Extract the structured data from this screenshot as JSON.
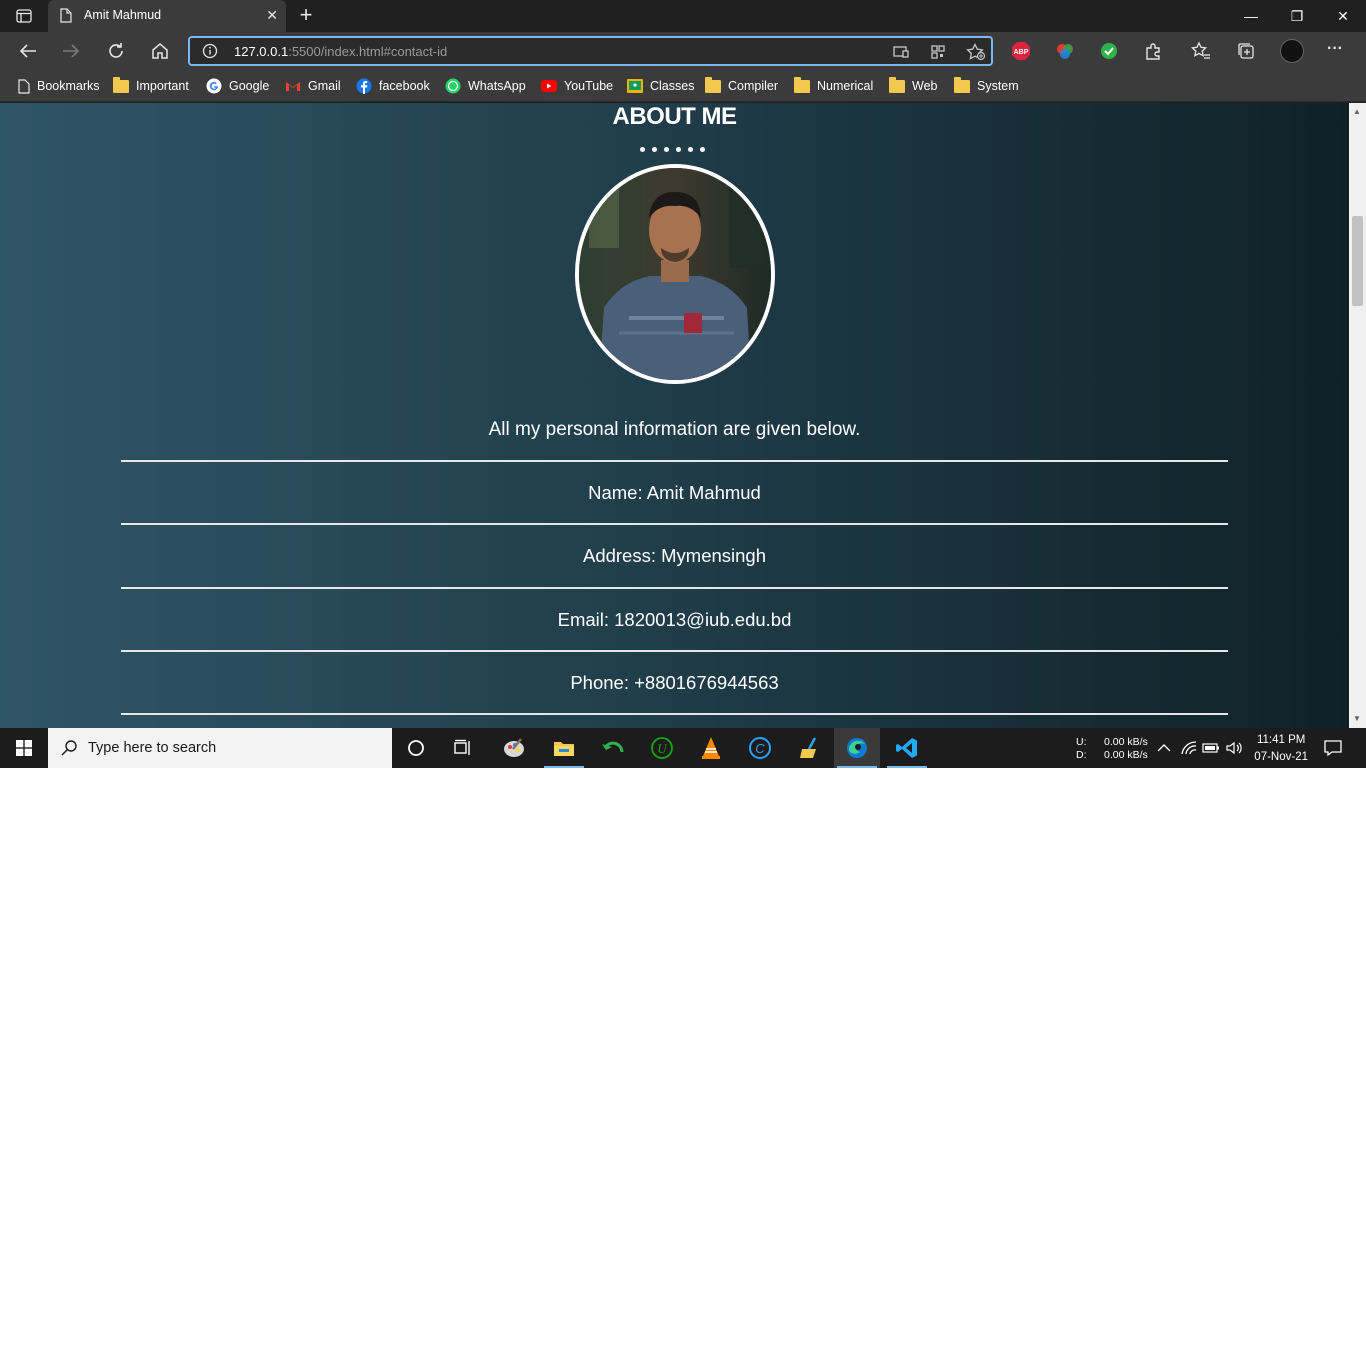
{
  "browser": {
    "tab": {
      "title": "Amit Mahmud",
      "close_glyph": "✕"
    },
    "new_tab_glyph": "+",
    "address": {
      "host": "127.0.0.1",
      "rest": ":5500/index.html#contact-id"
    },
    "window_controls": {
      "minimize": "—",
      "restore": "❐",
      "close": "✕"
    },
    "extensions": {
      "abp_label": "ABP"
    },
    "menu_glyph": "···"
  },
  "bookmarks": [
    {
      "label": "Bookmarks",
      "icon": "page-icon"
    },
    {
      "label": "Important",
      "icon": "folder-icon"
    },
    {
      "label": "Google",
      "icon": "google-icon"
    },
    {
      "label": "Gmail",
      "icon": "gmail-icon"
    },
    {
      "label": "facebook",
      "icon": "facebook-icon"
    },
    {
      "label": "WhatsApp",
      "icon": "whatsapp-icon"
    },
    {
      "label": "YouTube",
      "icon": "youtube-icon"
    },
    {
      "label": "Classes",
      "icon": "classroom-icon"
    },
    {
      "label": "Compiler",
      "icon": "folder-icon"
    },
    {
      "label": "Numerical",
      "icon": "folder-icon"
    },
    {
      "label": "Web",
      "icon": "folder-icon"
    },
    {
      "label": "System",
      "icon": "folder-icon"
    }
  ],
  "page": {
    "title": "ABOUT ME",
    "intro": "All my personal information are given below.",
    "info": [
      "Name: Amit Mahmud",
      "Address: Mymensingh",
      "Email: 1820013@iub.edu.bd",
      "Phone: +8801676944563"
    ]
  },
  "taskbar": {
    "search_placeholder": "Type here to search",
    "net": {
      "u_label": "U:",
      "d_label": "D:",
      "up": "0.00 kB/s",
      "down": "0.00 kB/s"
    },
    "time": "11:41 PM",
    "date": "07-Nov-21"
  },
  "colors": {
    "accent": "#76b9ed",
    "page_bg_left": "#2e5566",
    "page_bg_right": "#0f2127"
  }
}
